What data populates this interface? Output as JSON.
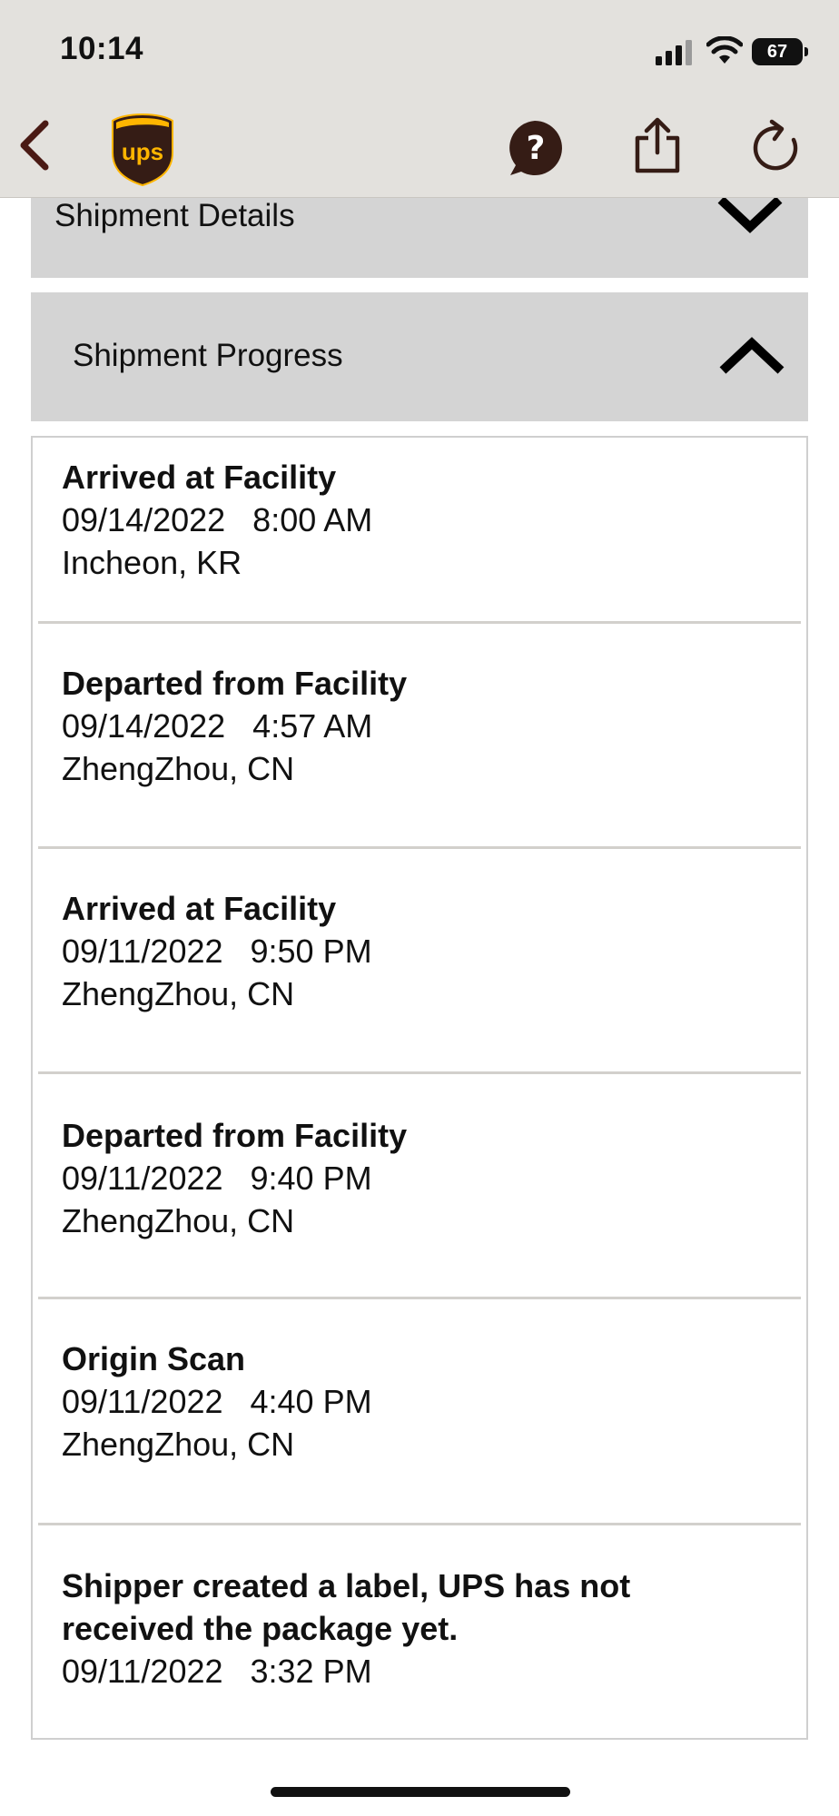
{
  "status_bar": {
    "time": "10:14",
    "battery": "67"
  },
  "nav": {
    "back_icon": "chevron-left-icon",
    "logo_text": "ups",
    "help_icon": "question-bubble-icon",
    "share_icon": "share-icon",
    "refresh_icon": "refresh-icon"
  },
  "sections": {
    "details_title": "Shipment Details",
    "progress_title": "Shipment Progress"
  },
  "events": [
    {
      "title": "Arrived at Facility",
      "datetime": "09/14/2022   8:00 AM",
      "location": "Incheon, KR"
    },
    {
      "title": "Departed from Facility",
      "datetime": "09/14/2022   4:57 AM",
      "location": "ZhengZhou, CN"
    },
    {
      "title": "Arrived at Facility",
      "datetime": "09/11/2022   9:50 PM",
      "location": "ZhengZhou, CN"
    },
    {
      "title": "Departed from Facility",
      "datetime": "09/11/2022   9:40 PM",
      "location": "ZhengZhou, CN"
    },
    {
      "title": "Origin Scan",
      "datetime": "09/11/2022   4:40 PM",
      "location": "ZhengZhou, CN"
    },
    {
      "title": "Shipper created a label, UPS has not received the package yet.",
      "datetime": "09/11/2022   3:32 PM",
      "location": ""
    }
  ],
  "colors": {
    "brand_brown": "#351c15",
    "brand_gold": "#ffb500",
    "header_bg": "#e3e1dd",
    "accordion_bg": "#d4d4d4"
  }
}
